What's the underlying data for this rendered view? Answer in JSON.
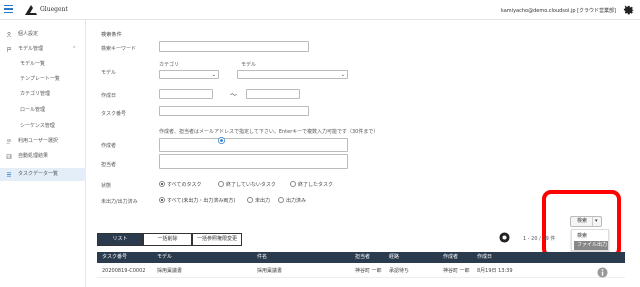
{
  "header": {
    "logo_text": "Gluegent",
    "user": "kamiyacho@demo.cloudsoi.jp [クラウド営業部]"
  },
  "sidebar": {
    "items": [
      {
        "label": "個人設定",
        "icon": "person-icon"
      },
      {
        "label": "モデル管理",
        "icon": "flag-icon",
        "caret": "⌃"
      },
      {
        "label": "モデル一覧"
      },
      {
        "label": "テンプレート一覧"
      },
      {
        "label": "カテゴリ管理"
      },
      {
        "label": "ロール管理"
      },
      {
        "label": "シーケンス管理"
      },
      {
        "label": "利用ユーザー選択",
        "icon": "users-icon"
      },
      {
        "label": "自動処理結果",
        "icon": "chart-icon"
      },
      {
        "label": "タスクデータ一覧",
        "icon": "list-icon"
      }
    ]
  },
  "search": {
    "section_title": "検索条件",
    "keyword_label": "検索キーワード",
    "model_label": "モデル",
    "category_label": "カテゴリ",
    "model_sub_label": "モデル",
    "created_label": "作成日",
    "tilde": "〜",
    "task_no_label": "タスク番号",
    "hint": "作成者、担当者はメールアドレスで指定して下さい。Enterキーで複数入力可能です（30件まで）",
    "creator_label": "作成者",
    "assignee_label": "担当者",
    "status_label": "状態",
    "status_options": [
      "すべてのタスク",
      "終了していないタスク",
      "終了したタスク"
    ],
    "output_label": "未出力/出力済み",
    "output_options": [
      "すべて(未出力・出力済み両方)",
      "未出力",
      "出力済み"
    ],
    "search_button": "検索",
    "dropdown_arrow": "▾",
    "dropdown": [
      "検索",
      "ファイル出力"
    ]
  },
  "list": {
    "tabs": [
      "リスト",
      "一括削除",
      "一括参照権限変更"
    ],
    "pager": "1 - 20 / 19 件",
    "columns": [
      "タスク番号",
      "モデル",
      "件名",
      "担当者",
      "経路",
      "作成者",
      "作成日"
    ],
    "rows": [
      [
        "20200819-C0002",
        "採用稟議書",
        "採用稟議書",
        "神谷町 一郎",
        "承認待ち",
        "神谷町 一郎",
        "8月19日 13:39"
      ]
    ]
  },
  "colors": {
    "accent": "#2a78c8",
    "header_dark": "#2b3b4e",
    "highlight": "#ff0000"
  }
}
